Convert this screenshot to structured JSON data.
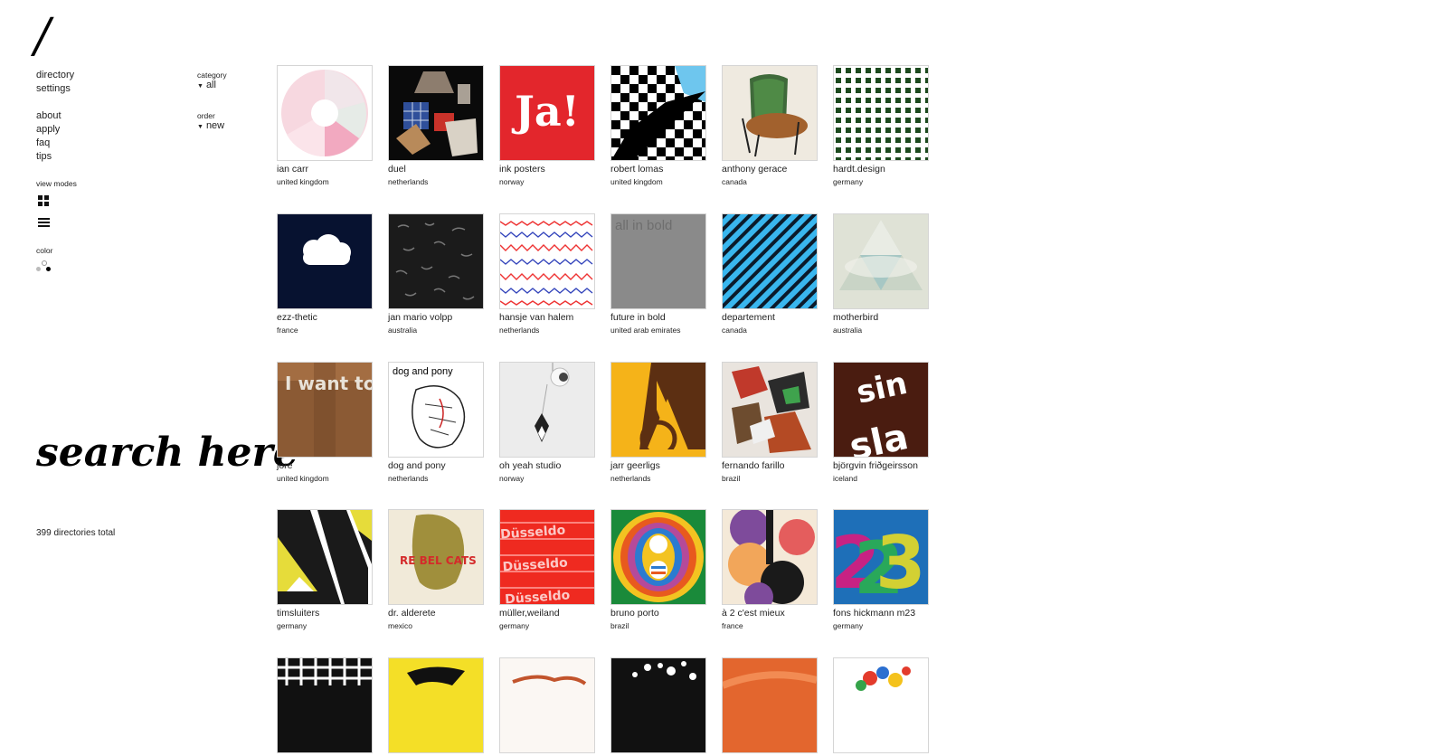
{
  "logo": "/",
  "nav": {
    "primary": [
      "directory",
      "settings"
    ],
    "secondary": [
      "about",
      "apply",
      "faq",
      "tips"
    ]
  },
  "filters": {
    "category_label": "category",
    "category_value": "all",
    "order_label": "order",
    "order_value": "new"
  },
  "view_modes_label": "view modes",
  "color_label": "color",
  "search_text": "search here",
  "total_text": "399 directories total",
  "tiles": [
    {
      "name": "ian carr",
      "country": "united kingdom"
    },
    {
      "name": "duel",
      "country": "netherlands"
    },
    {
      "name": "ink posters",
      "country": "norway"
    },
    {
      "name": "robert lomas",
      "country": "united kingdom"
    },
    {
      "name": "anthony gerace",
      "country": "canada"
    },
    {
      "name": "hardt.design",
      "country": "germany"
    },
    {
      "name": "ezz-thetic",
      "country": "france"
    },
    {
      "name": "jan mario volpp",
      "country": "australia"
    },
    {
      "name": "hansje van halem",
      "country": "netherlands"
    },
    {
      "name": "future in bold",
      "country": "united arab emirates"
    },
    {
      "name": "departement",
      "country": "canada"
    },
    {
      "name": "motherbird",
      "country": "australia"
    },
    {
      "name": "jore",
      "country": "united kingdom"
    },
    {
      "name": "dog and pony",
      "country": "netherlands"
    },
    {
      "name": "oh yeah studio",
      "country": "norway"
    },
    {
      "name": "jarr geerligs",
      "country": "netherlands"
    },
    {
      "name": "fernando farillo",
      "country": "brazil"
    },
    {
      "name": "björgvin friðgeirsson",
      "country": "iceland"
    },
    {
      "name": "timsluiters",
      "country": "germany"
    },
    {
      "name": "dr. alderete",
      "country": "mexico"
    },
    {
      "name": "müller,weiland",
      "country": "germany"
    },
    {
      "name": "bruno porto",
      "country": "brazil"
    },
    {
      "name": "à 2 c'est mieux",
      "country": "france"
    },
    {
      "name": "fons hickmann m23",
      "country": "germany"
    },
    {
      "name": "",
      "country": ""
    },
    {
      "name": "",
      "country": ""
    },
    {
      "name": "",
      "country": ""
    },
    {
      "name": "",
      "country": ""
    },
    {
      "name": "",
      "country": ""
    },
    {
      "name": "",
      "country": ""
    }
  ],
  "thumb_texts": {
    "ink_posters": "Ja!",
    "future_in_bold": "all in bold",
    "dog_and_pony": "dog and pony",
    "jore": "I want to",
    "dr_alderete": "RE BEL CATS"
  },
  "colors": {
    "accent": "#000000",
    "ink_red": "#e3262c",
    "navy": "#071230",
    "cyan": "#39b6ee"
  }
}
